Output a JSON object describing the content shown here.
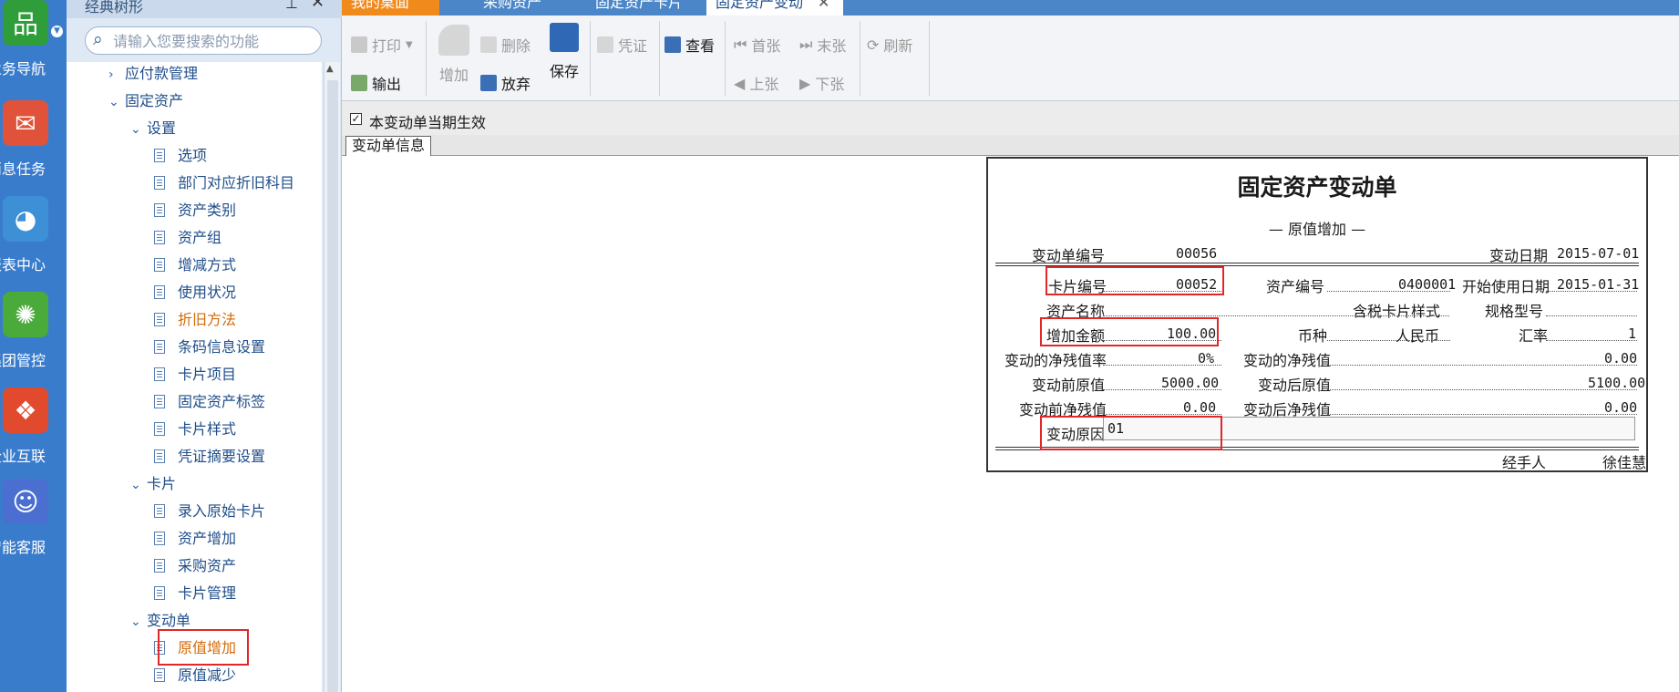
{
  "rail": {
    "items": [
      {
        "label": "业务导航",
        "icon": "tree-nav-icon",
        "color": "#2f9e3a"
      },
      {
        "label": "消息任务",
        "icon": "envelope-icon",
        "color": "#e0533a"
      },
      {
        "label": "报表中心",
        "icon": "report-chart-icon",
        "color": "#3d8fd6"
      },
      {
        "label": "集团管控",
        "icon": "network-icon",
        "color": "#4aaa3a"
      },
      {
        "label": "企业互联",
        "icon": "connect-icon",
        "color": "#e24a2e"
      },
      {
        "label": "智能客服",
        "icon": "headset-icon",
        "color": "#4a6fd0"
      }
    ]
  },
  "nav": {
    "title": "经典树形",
    "search_placeholder": "请输入您要搜索的功能",
    "tree": [
      {
        "label": "应付款管理",
        "kind": "collapsed",
        "level": 1
      },
      {
        "label": "固定资产",
        "kind": "expanded",
        "level": 1
      },
      {
        "label": "设置",
        "kind": "expanded",
        "level": 2
      },
      {
        "label": "选项",
        "kind": "leaf",
        "level": 3
      },
      {
        "label": "部门对应折旧科目",
        "kind": "leaf",
        "level": 3
      },
      {
        "label": "资产类别",
        "kind": "leaf",
        "level": 3
      },
      {
        "label": "资产组",
        "kind": "leaf",
        "level": 3
      },
      {
        "label": "增减方式",
        "kind": "leaf",
        "level": 3
      },
      {
        "label": "使用状况",
        "kind": "leaf",
        "level": 3
      },
      {
        "label": "折旧方法",
        "kind": "leaf",
        "level": 3,
        "highlight": true
      },
      {
        "label": "条码信息设置",
        "kind": "leaf",
        "level": 3
      },
      {
        "label": "卡片项目",
        "kind": "leaf",
        "level": 3
      },
      {
        "label": "固定资产标签",
        "kind": "leaf",
        "level": 3
      },
      {
        "label": "卡片样式",
        "kind": "leaf",
        "level": 3
      },
      {
        "label": "凭证摘要设置",
        "kind": "leaf",
        "level": 3
      },
      {
        "label": "卡片",
        "kind": "expanded",
        "level": 2
      },
      {
        "label": "录入原始卡片",
        "kind": "leaf",
        "level": 3
      },
      {
        "label": "资产增加",
        "kind": "leaf",
        "level": 3
      },
      {
        "label": "采购资产",
        "kind": "leaf",
        "level": 3
      },
      {
        "label": "卡片管理",
        "kind": "leaf",
        "level": 3
      },
      {
        "label": "变动单",
        "kind": "expanded",
        "level": 2
      },
      {
        "label": "原值增加",
        "kind": "leaf",
        "level": 3,
        "highlight": true
      },
      {
        "label": "原值减少",
        "kind": "leaf",
        "level": 3
      }
    ]
  },
  "tabs": [
    {
      "label": "我的桌面",
      "active": false,
      "color": "#f08a1c"
    },
    {
      "label": "采购资产",
      "active": false
    },
    {
      "label": "固定资产卡片",
      "active": false
    },
    {
      "label": "固定资产变动",
      "active": true
    }
  ],
  "toolbar": {
    "print": "打印",
    "output": "输出",
    "add": "增加",
    "delete": "删除",
    "discard": "放弃",
    "save": "保存",
    "voucher": "凭证",
    "view": "查看",
    "first": "首张",
    "last": "末张",
    "prev": "上张",
    "next": "下张",
    "refresh": "刷新"
  },
  "effect_checkbox": {
    "label": "本变动单当期生效",
    "checked": "✓"
  },
  "subtab": "变动单信息",
  "form": {
    "title": "固定资产变动单",
    "subtitle": "— 原值增加 —",
    "change_no_label": "变动单编号",
    "change_no": "00056",
    "change_date_label": "变动日期",
    "change_date": "2015-07-01",
    "card_no_label": "卡片编号",
    "card_no": "00052",
    "asset_no_label": "资产编号",
    "asset_no": "0400001",
    "start_date_label": "开始使用日期",
    "start_date": "2015-01-31",
    "asset_name_label": "资产名称",
    "asset_name": "含税卡片样式",
    "spec_label": "规格型号",
    "spec": "",
    "increase_label": "增加金额",
    "increase": "100.00",
    "currency_label": "币种",
    "currency": "人民币",
    "rate_label": "汇率",
    "rate": "1",
    "salvage_rate_label": "变动的净残值率",
    "salvage_rate": "0%",
    "salvage_label": "变动的净残值",
    "salvage": "0.00",
    "orig_before_label": "变动前原值",
    "orig_before": "5000.00",
    "orig_after_label": "变动后原值",
    "orig_after": "5100.00",
    "net_before_label": "变动前净残值",
    "net_before": "0.00",
    "net_after_label": "变动后净残值",
    "net_after": "0.00",
    "reason_label": "变动原因",
    "reason": "01",
    "handler_label": "经手人",
    "handler": "徐佳慧"
  },
  "colors": {
    "highlight_box": "#e02828",
    "rail": "#3a7ccc",
    "active_tree_item": "#d46a0a"
  }
}
